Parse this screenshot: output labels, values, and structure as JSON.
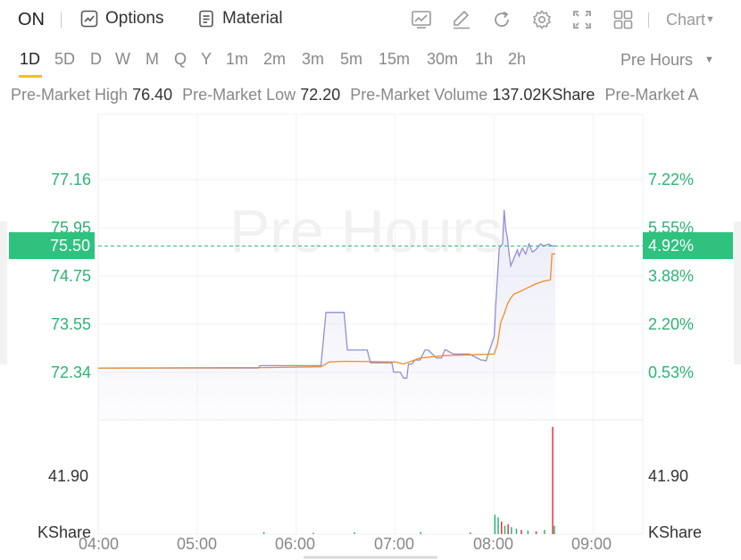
{
  "header": {
    "ticker": "ON",
    "options_label": "Options",
    "material_label": "Material",
    "chart_label": "Chart",
    "tools": [
      "chart-line-icon",
      "pen-icon",
      "refresh-icon",
      "gear-icon",
      "fullscreen-icon",
      "grid-icon"
    ]
  },
  "timeframes": {
    "items": [
      "1D",
      "5D",
      "D",
      "W",
      "M",
      "Q",
      "Y",
      "1m",
      "2m",
      "3m",
      "5m",
      "15m",
      "30m",
      "1h",
      "2h"
    ],
    "active": "1D",
    "session": "Pre Hours"
  },
  "stats": {
    "high_label": "Pre-Market High",
    "high_value": "76.40",
    "low_label": "Pre-Market Low",
    "low_value": "72.20",
    "volume_label": "Pre-Market Volume",
    "volume_value": "137.02KShare",
    "amount_label": "Pre-Market A"
  },
  "watermark": "Pre Hours",
  "colors": {
    "up": "#2bb573",
    "price_line": "#8f8fd6",
    "avg_line": "#f08c2a",
    "badge": "#2ec27e",
    "volume_up": "#2bb573",
    "volume_down": "#e8333f"
  },
  "chart_data": {
    "type": "line",
    "current_price": "75.50",
    "current_change": "4.92%",
    "y_ticks_price": [
      "77.16",
      "75.95",
      "74.75",
      "73.55",
      "72.34"
    ],
    "y_ticks_pct": [
      "7.22%",
      "5.55%",
      "3.88%",
      "2.20%",
      "0.53%"
    ],
    "volume_tick": "41.90",
    "volume_unit": "KShare",
    "x_ticks": [
      "04:00",
      "05:00",
      "06:00",
      "07:00",
      "08:00",
      "09:00"
    ],
    "ylim": [
      71.0,
      78.0
    ],
    "series": [
      {
        "x": [
          "04:00",
          "05:37",
          "05:38",
          "06:15",
          "06:18",
          "06:29",
          "06:31",
          "06:43",
          "06:45",
          "06:58",
          "06:59",
          "07:03",
          "07:05",
          "07:07",
          "07:08",
          "07:10",
          "07:12",
          "07:15",
          "07:18",
          "07:20",
          "07:25",
          "07:28",
          "07:30",
          "07:31",
          "07:35",
          "07:45",
          "07:52",
          "07:53",
          "07:55",
          "08:00",
          "08:01",
          "08:03",
          "08:05",
          "08:06",
          "08:07",
          "08:08",
          "08:09",
          "08:10",
          "08:12",
          "08:14",
          "08:15",
          "08:17",
          "08:19",
          "08:21",
          "08:23",
          "08:25",
          "08:28",
          "08:30",
          "08:33",
          "08:35",
          "08:37"
        ],
        "values": [
          72.45,
          72.45,
          72.51,
          72.51,
          73.84,
          73.84,
          72.9,
          72.9,
          72.58,
          72.58,
          72.35,
          72.35,
          72.2,
          72.2,
          72.55,
          72.55,
          72.65,
          72.65,
          72.9,
          72.9,
          72.7,
          72.7,
          72.9,
          72.9,
          72.8,
          72.8,
          72.65,
          72.65,
          72.63,
          73.25,
          74.1,
          75.45,
          75.55,
          76.4,
          75.9,
          75.7,
          75.3,
          75.0,
          75.2,
          75.4,
          75.25,
          75.45,
          75.3,
          75.55,
          75.35,
          75.4,
          75.55,
          75.5,
          75.55,
          75.5,
          75.5
        ]
      },
      {
        "x": [
          "04:00",
          "05:40",
          "06:15",
          "06:20",
          "06:30",
          "06:45",
          "07:00",
          "07:05",
          "07:15",
          "07:30",
          "07:45",
          "08:00",
          "08:02",
          "08:04",
          "08:06",
          "08:08",
          "08:10",
          "08:12",
          "08:15",
          "08:20",
          "08:25",
          "08:30",
          "08:34",
          "08:35",
          "08:37"
        ],
        "values": [
          72.45,
          72.46,
          72.48,
          72.6,
          72.62,
          72.61,
          72.6,
          72.55,
          72.7,
          72.76,
          72.78,
          72.8,
          73.05,
          73.6,
          73.8,
          74.05,
          74.2,
          74.3,
          74.35,
          74.45,
          74.55,
          74.62,
          74.65,
          75.3,
          75.3
        ]
      }
    ],
    "volume": {
      "x": [
        "05:40",
        "06:10",
        "06:35",
        "07:15",
        "07:45",
        "08:00",
        "08:02",
        "08:04",
        "08:06",
        "08:08",
        "08:10",
        "08:13",
        "08:16",
        "08:20",
        "08:25",
        "08:30",
        "08:35",
        "08:36"
      ],
      "values": [
        1.5,
        1.0,
        1.2,
        1.5,
        1.0,
        14.0,
        12.0,
        9.0,
        6.0,
        7.0,
        5.0,
        4.0,
        3.0,
        2.5,
        2.0,
        3.0,
        110.0,
        6.0
      ],
      "direction": [
        "up",
        "up",
        "up",
        "up",
        "down",
        "up",
        "up",
        "down",
        "up",
        "down",
        "up",
        "up",
        "down",
        "up",
        "down",
        "up",
        "down",
        "up"
      ]
    }
  }
}
